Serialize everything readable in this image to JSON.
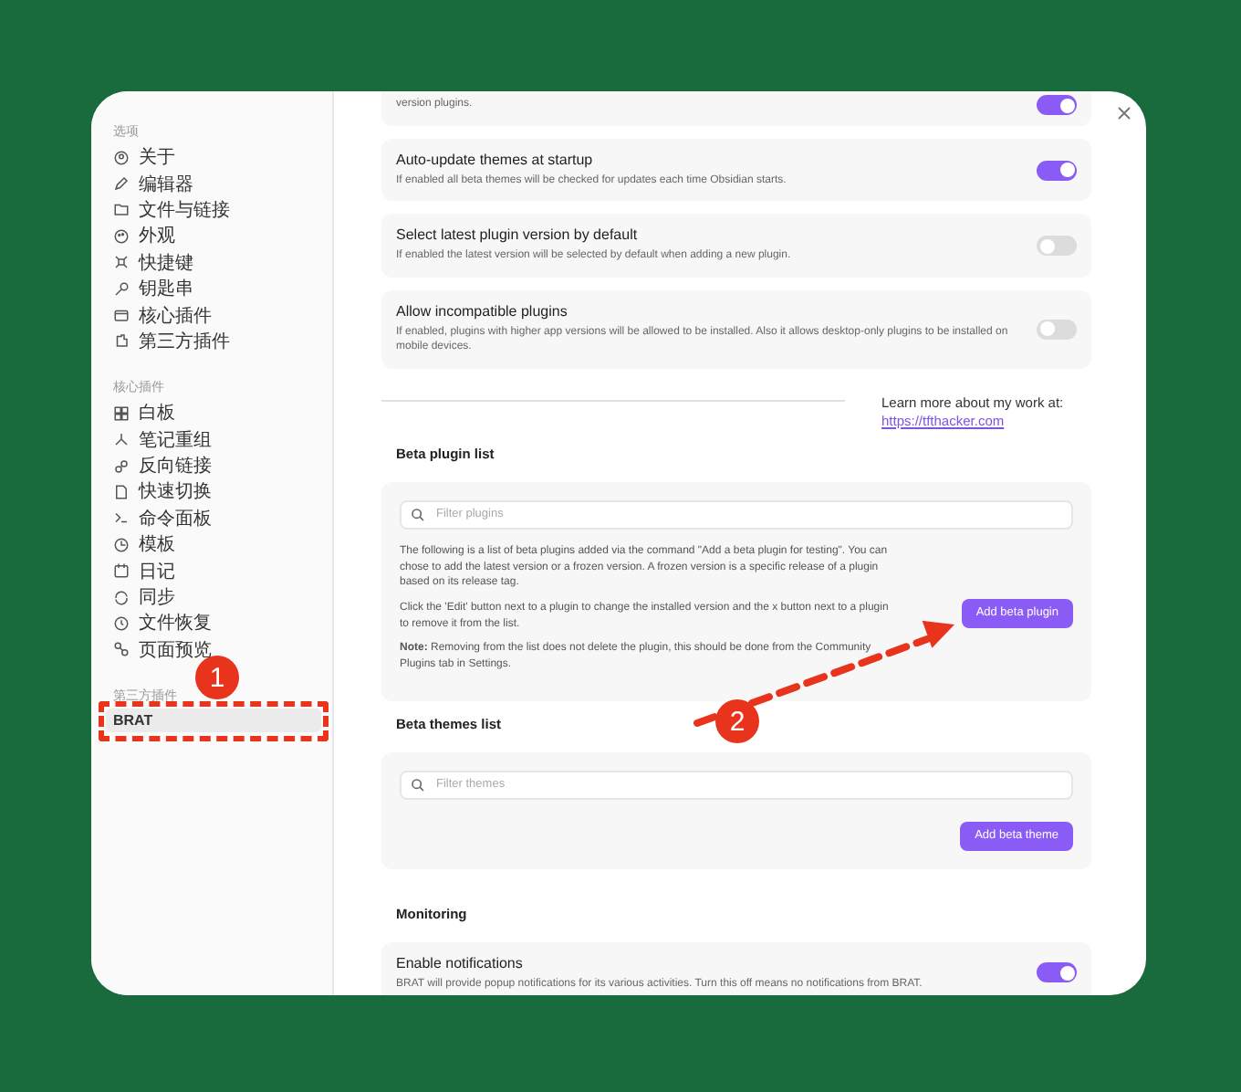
{
  "sidebar": {
    "sections": [
      {
        "title": "选项",
        "items": [
          {
            "label": "关于",
            "selected": false
          },
          {
            "label": "编辑器",
            "selected": false
          },
          {
            "label": "文件与链接",
            "selected": false
          },
          {
            "label": "外观",
            "selected": false
          },
          {
            "label": "快捷键",
            "selected": false
          },
          {
            "label": "钥匙串",
            "selected": false
          },
          {
            "label": "核心插件",
            "selected": false
          },
          {
            "label": "第三方插件",
            "selected": false
          }
        ]
      },
      {
        "title": "核心插件",
        "items": [
          {
            "label": "白板",
            "selected": false
          },
          {
            "label": "笔记重组",
            "selected": false
          },
          {
            "label": "反向链接",
            "selected": false
          },
          {
            "label": "快速切换",
            "selected": false
          },
          {
            "label": "命令面板",
            "selected": false
          },
          {
            "label": "模板",
            "selected": false
          },
          {
            "label": "日记",
            "selected": false
          },
          {
            "label": "同步",
            "selected": false
          },
          {
            "label": "文件恢复",
            "selected": false
          },
          {
            "label": "页面预览",
            "selected": false
          }
        ]
      },
      {
        "title": "第三方插件",
        "items": [
          {
            "label": "BRAT",
            "selected": true
          }
        ]
      }
    ]
  },
  "top_settings": [
    {
      "description": "version plugins.",
      "on": true
    },
    {
      "name": "Auto-update themes at startup",
      "description": "If enabled all beta themes will be checked for updates each time Obsidian starts.",
      "on": true
    },
    {
      "name": "Select latest plugin version by default",
      "description": "If enabled the latest version will be selected by default when adding a new plugin.",
      "on": false
    },
    {
      "name": "Allow incompatible plugins",
      "description": "If enabled, plugins with higher app versions will be allowed to be installed. Also it allows desktop-only plugins to be installed on mobile devices.",
      "on": false
    }
  ],
  "learn_more": {
    "text": "Learn more about my work at:",
    "link": "https://tfthacker.com"
  },
  "beta_plugins": {
    "heading": "Beta plugin list",
    "placeholder": "Filter plugins",
    "paragraphs": [
      "The following is a list of beta plugins added via the command \"Add a beta plugin for testing\". You can chose to add the latest version or a frozen version. A frozen version is a specific release of a plugin based on its release tag.",
      "Click the 'Edit' button next to a plugin to change the installed version and the x button next to a plugin to remove it from the list.",
      "**Note:** Removing from the list does not delete the plugin, this should be done from the Community Plugins tab in Settings."
    ],
    "button": "Add beta plugin"
  },
  "beta_themes": {
    "heading": "Beta themes list",
    "placeholder": "Filter themes",
    "button": "Add beta theme"
  },
  "monitoring": {
    "heading": "Monitoring",
    "settings": [
      {
        "name": "Enable notifications",
        "description": "BRAT will provide popup notifications for its various activities. Turn this off means no notifications from BRAT.",
        "on": true
      }
    ]
  },
  "annotations": [
    {
      "label": "1"
    },
    {
      "label": "2"
    }
  ]
}
